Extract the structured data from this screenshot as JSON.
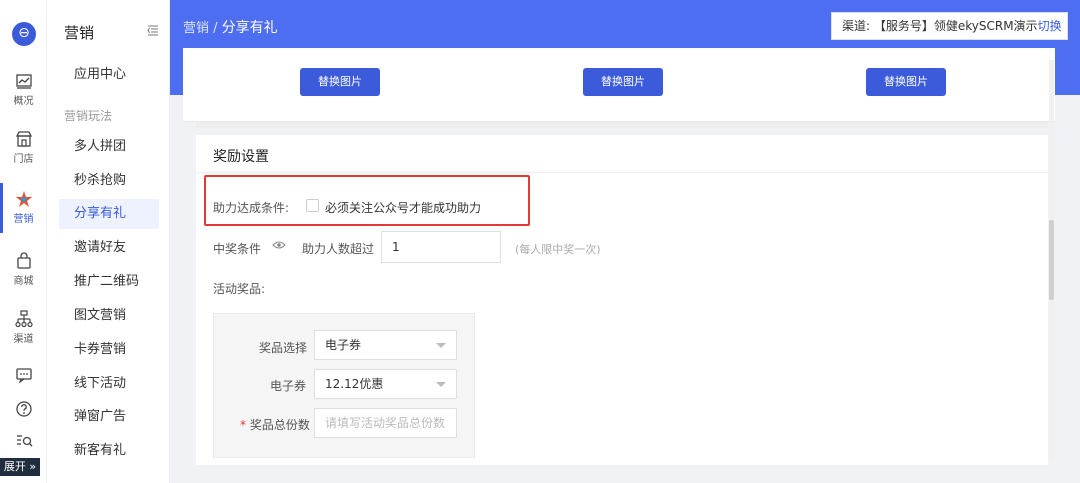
{
  "rail": {
    "items": [
      {
        "label": "概况",
        "icon": "chart-icon"
      },
      {
        "label": "门店",
        "icon": "store-icon"
      },
      {
        "label": "营销",
        "icon": "marketing-icon"
      },
      {
        "label": "商城",
        "icon": "shop-bag-icon"
      },
      {
        "label": "渠道",
        "icon": "channel-tree-icon"
      }
    ],
    "expand_label": "展开 »"
  },
  "nav2": {
    "title": "营销",
    "app_center": "应用中心",
    "group_label": "营销玩法",
    "items": [
      "多人拼团",
      "秒杀抢购",
      "分享有礼",
      "邀请好友",
      "推广二维码",
      "图文营销",
      "卡券营销",
      "线下活动",
      "弹窗广告",
      "新客有礼"
    ],
    "active_index": 2
  },
  "breadcrumb": {
    "parent": "营销",
    "separator": " / ",
    "current": "分享有礼"
  },
  "channel": {
    "prefix": "渠道: ",
    "value": "【服务号】领健ekySCRM演示",
    "switch_label": "切换"
  },
  "image_section": {
    "replace_labels": [
      "替换图片",
      "替换图片",
      "替换图片"
    ]
  },
  "reward": {
    "title": "奖励设置",
    "assist_condition_label": "助力达成条件:",
    "assist_condition_option": "必须关注公众号才能成功助力",
    "win_condition_label": "中奖条件",
    "assist_count_label": "助力人数超过",
    "assist_count_value": "1",
    "hint": "(每人限中奖一次)",
    "prize_label": "活动奖品:",
    "prize_type_label": "奖品选择",
    "prize_type_value": "电子券",
    "coupon_label": "电子券",
    "coupon_value": "12.12优惠",
    "total_required": "*",
    "total_label": "奖品总份数",
    "total_placeholder": "请填写活动奖品总份数"
  },
  "colors": {
    "accent": "#3b5bdb",
    "header": "#4e6ef2",
    "highlight": "#e53935"
  }
}
